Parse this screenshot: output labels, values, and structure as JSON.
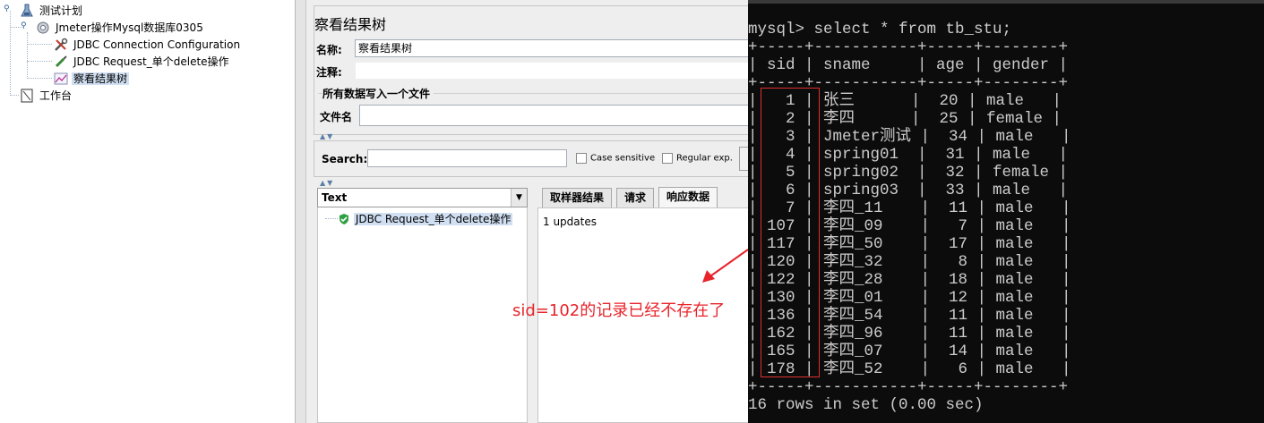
{
  "tree": {
    "items": [
      {
        "label": "测试计划",
        "icon": "test-plan-icon"
      },
      {
        "label": "Jmeter操作Mysql数据库0305",
        "icon": "thread-group-gear-icon"
      },
      {
        "label": "JDBC Connection Configuration",
        "icon": "config-wrench-icon"
      },
      {
        "label": "JDBC Request_单个delete操作",
        "icon": "sampler-pipette-icon"
      },
      {
        "label": "察看结果树",
        "icon": "results-tree-chart-icon"
      },
      {
        "label": "工作台",
        "icon": "workbench-notebook-icon"
      }
    ]
  },
  "panel": {
    "title": "察看结果树",
    "name_label": "名称:",
    "name_value": "察看结果树",
    "comment_label": "注释:",
    "comment_value": "",
    "file_group_title": "所有数据写入一个文件",
    "filename_label": "文件名",
    "filename_value": "",
    "search_label": "Search:",
    "search_value": "",
    "case_sensitive_label": "Case sensitive",
    "regex_label": "Regular exp.",
    "renderer_value": "Text",
    "results": [
      {
        "label": "JDBC Request_单个delete操作",
        "status": "success"
      }
    ],
    "tabs": [
      "取样器结果",
      "请求",
      "响应数据"
    ],
    "active_tab": "响应数据",
    "response_text": "1 updates"
  },
  "annotation": "sid=102的记录已经不存在了",
  "console": {
    "command": "mysql> select * from tb_stu;",
    "separator": "+-----+-----------+-----+--------+",
    "header": "| sid | sname     | age | gender |",
    "rows": [
      "|   1 | 张三      |  20 | male   |",
      "|   2 | 李四      |  25 | female |",
      "|   3 | Jmeter测试 |  34 | male   |",
      "|   4 | spring01  |  31 | male   |",
      "|   5 | spring02  |  32 | female |",
      "|   6 | spring03  |  33 | male   |",
      "|   7 | 李四_11    |  11 | male   |",
      "| 107 | 李四_09    |   7 | male   |",
      "| 117 | 李四_50    |  17 | male   |",
      "| 120 | 李四_32    |   8 | male   |",
      "| 122 | 李四_28    |  18 | male   |",
      "| 130 | 李四_01    |  12 | male   |",
      "| 136 | 李四_54    |  11 | male   |",
      "| 162 | 李四_96    |  11 | male   |",
      "| 165 | 李四_07    |  14 | male   |",
      "| 178 | 李四_52    |   6 | male   |"
    ],
    "footer": "16 rows in set (0.00 sec)"
  },
  "colors": {
    "selection": "#d0dff2",
    "annotation_red": "#e8242b",
    "console_bg": "#0c0c0c",
    "console_text": "#cccccc"
  }
}
